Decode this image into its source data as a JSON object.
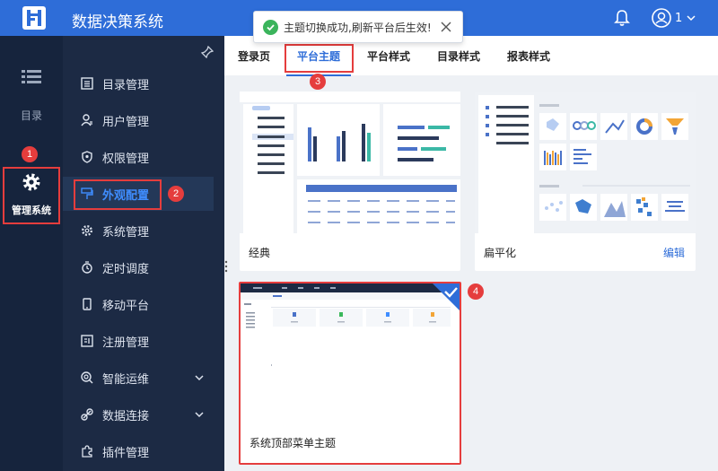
{
  "app": {
    "title": "数据决策系统"
  },
  "user": {
    "name": "1"
  },
  "toast": {
    "message": "主题切换成功,刷新平台后生效!"
  },
  "leftnav": {
    "catalog_label": "目录",
    "management_label": "管理系统"
  },
  "sidebar": {
    "items": [
      {
        "label": "目录管理",
        "icon": "catalog-icon"
      },
      {
        "label": "用户管理",
        "icon": "user-icon"
      },
      {
        "label": "权限管理",
        "icon": "shield-icon"
      },
      {
        "label": "外观配置",
        "icon": "paint-icon"
      },
      {
        "label": "系统管理",
        "icon": "gear-icon"
      },
      {
        "label": "定时调度",
        "icon": "timer-icon"
      },
      {
        "label": "移动平台",
        "icon": "mobile-icon"
      },
      {
        "label": "注册管理",
        "icon": "register-icon"
      },
      {
        "label": "智能运维",
        "icon": "ops-icon"
      },
      {
        "label": "数据连接",
        "icon": "link-icon"
      },
      {
        "label": "插件管理",
        "icon": "plugin-icon"
      }
    ]
  },
  "tabs": [
    {
      "label": "登录页"
    },
    {
      "label": "平台主题"
    },
    {
      "label": "平台样式"
    },
    {
      "label": "目录样式"
    },
    {
      "label": "报表样式"
    }
  ],
  "themes": [
    {
      "name": "经典",
      "edit_label": ""
    },
    {
      "name": "扁平化",
      "edit_label": "编辑"
    },
    {
      "name": "系统顶部菜单主题",
      "edit_label": ""
    }
  ],
  "markers": [
    "1",
    "2",
    "3",
    "4"
  ],
  "colors": {
    "topbar": "#2e6dd8",
    "sidebar": "#1c2a44",
    "accent": "#2e6dd8",
    "highlight": "#e53d3d",
    "success": "#3bb45c"
  }
}
